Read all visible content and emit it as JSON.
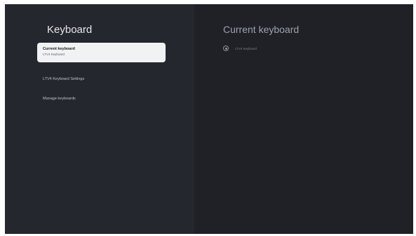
{
  "left": {
    "title": "Keyboard",
    "items": [
      {
        "label": "Current keyboard",
        "sublabel": "LTV4 Keyboard"
      },
      {
        "label": "LTV4 Keyboard Settings"
      },
      {
        "label": "Manage keyboards"
      }
    ]
  },
  "right": {
    "title": "Current keyboard",
    "options": [
      {
        "label": "LTV4 Keyboard",
        "selected": true
      }
    ]
  },
  "colors": {
    "background": "#1f2127",
    "panel": "#25272e",
    "selected_item": "#f1f2f4"
  }
}
